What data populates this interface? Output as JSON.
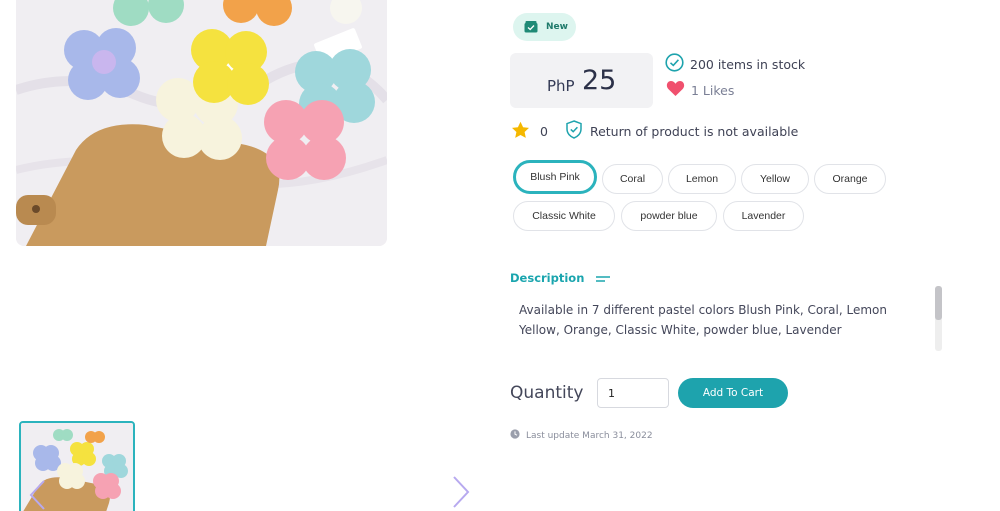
{
  "badge": {
    "label": "New"
  },
  "price": {
    "currency": "PhP",
    "amount": "25"
  },
  "stock": {
    "text": "200 items in stock"
  },
  "likes": {
    "text": "1 Likes"
  },
  "rating": {
    "value": "0"
  },
  "return_policy": {
    "text": "Return of product is not available"
  },
  "variants": {
    "selected": "Blush Pink",
    "options": [
      "Blush Pink",
      "Coral",
      "Lemon",
      "Yellow",
      "Orange",
      "Classic White",
      "powder blue",
      "Lavender"
    ]
  },
  "description": {
    "tab_label": "Description",
    "text": "Available in 7 different pastel colors Blush Pink, Coral, Lemon Yellow, Orange, Classic White, powder blue, Lavender"
  },
  "purchase": {
    "quantity_label": "Quantity",
    "quantity_value": "1",
    "add_to_cart_label": "Add To Cart"
  },
  "last_update": {
    "text": "Last update March 31, 2022"
  },
  "colors": {
    "accent": "#1ea3ad",
    "selected_border": "#2bb3bd",
    "heart": "#f0506e",
    "star": "#f5b800",
    "badge_bg": "#ddf5ef"
  },
  "icons": {
    "badge": "new-box-icon",
    "stock": "check-circle-icon",
    "likes": "heart-icon",
    "rating": "star-icon",
    "return": "shield-check-icon",
    "description": "text-lines-icon",
    "update": "clock-icon",
    "prev": "chevron-left-icon",
    "next": "chevron-right-icon"
  }
}
